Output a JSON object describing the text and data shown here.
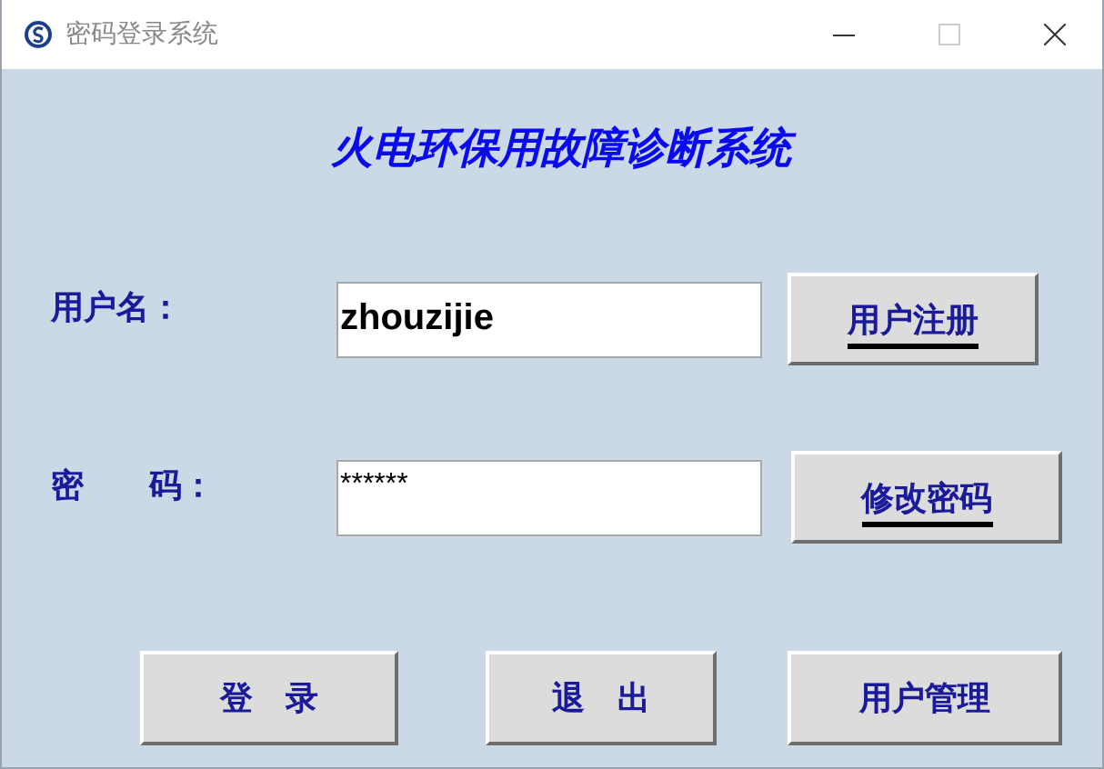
{
  "window": {
    "title": "密码登录系统"
  },
  "heading": "火电环保用故障诊断系统",
  "fields": [
    {
      "label": "用户名：",
      "value": "zhouzijie",
      "kind": "text",
      "button": {
        "label": "用户注册",
        "underlined": true
      }
    },
    {
      "label": "密　　码：",
      "value": "******",
      "kind": "password",
      "button": {
        "label": "修改密码",
        "underlined": true
      }
    }
  ],
  "buttons": [
    "登　录",
    "退　出",
    "用户管理"
  ]
}
